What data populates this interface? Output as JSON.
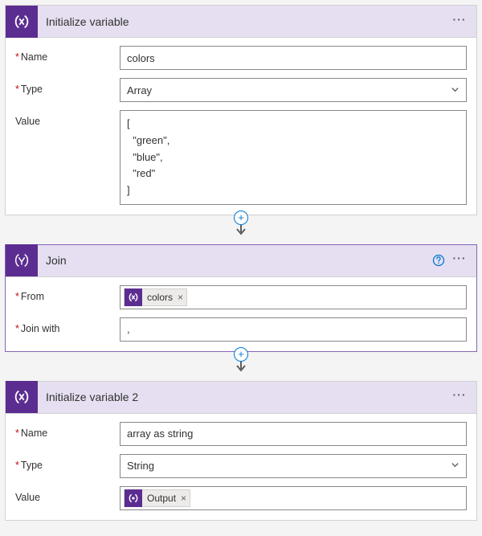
{
  "action1": {
    "title": "Initialize variable",
    "fields": {
      "name_label": "Name",
      "name_value": "colors",
      "type_label": "Type",
      "type_value": "Array",
      "value_label": "Value",
      "value_value": "[\n  \"green\",\n  \"blue\",\n  \"red\"\n]"
    }
  },
  "action2": {
    "title": "Join",
    "fields": {
      "from_label": "From",
      "from_token": "colors",
      "joinwith_label": "Join with",
      "joinwith_value": ","
    }
  },
  "action3": {
    "title": "Initialize variable 2",
    "fields": {
      "name_label": "Name",
      "name_value": "array as string",
      "type_label": "Type",
      "type_value": "String",
      "value_label": "Value",
      "value_token": "Output"
    }
  },
  "ui": {
    "token_remove": "×",
    "plus": "+",
    "dots": "···"
  }
}
